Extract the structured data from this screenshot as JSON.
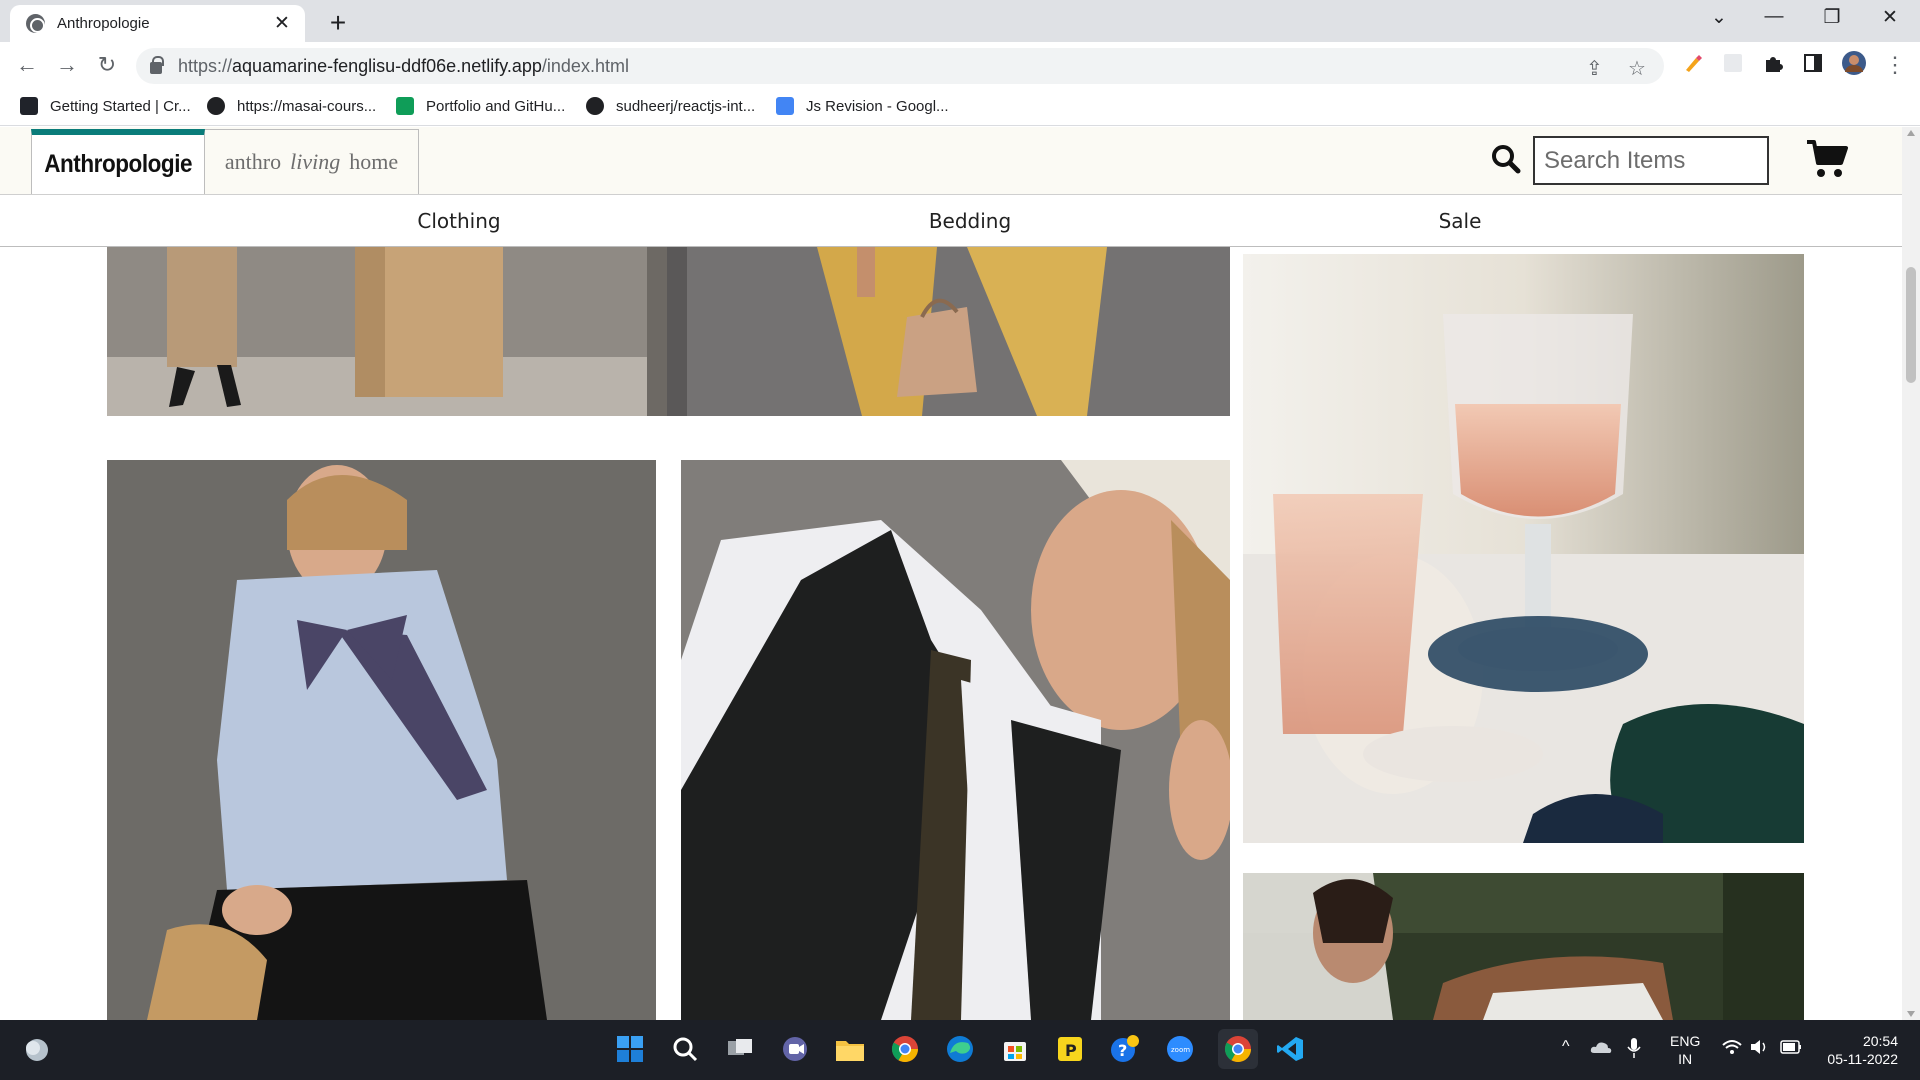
{
  "browser": {
    "tab_title": "Anthropologie",
    "url_scheme": "https://",
    "url_host": "aquamarine-fenglisu-ddf06e.netlify.app",
    "url_path": "/index.html",
    "bookmarks": [
      {
        "label": "Getting Started | Cr...",
        "icon": "react-icon",
        "color": "#20232a"
      },
      {
        "label": "https://masai-cours...",
        "icon": "globe-icon",
        "color": "#202124"
      },
      {
        "label": "Portfolio and GitHu...",
        "icon": "sheets-icon",
        "color": "#0f9d58"
      },
      {
        "label": "sudheerj/reactjs-int...",
        "icon": "github-icon",
        "color": "#202124"
      },
      {
        "label": "Js Revision - Googl...",
        "icon": "docs-icon",
        "color": "#4285f4"
      }
    ]
  },
  "site": {
    "brand": "Anthropologie",
    "home_tab": {
      "part1": "anthro",
      "part2": "living",
      "part3": "home"
    },
    "search_placeholder": "Search Items",
    "nav": [
      "Clothing",
      "Bedding",
      "Sale"
    ],
    "accent_color": "#0a7c7a"
  },
  "gallery": [
    {
      "name": "photo-model-tan-trousers-boxes"
    },
    {
      "name": "photo-model-yellow-check-trousers-handbag"
    },
    {
      "name": "photo-rose-wine-glasses-coasters"
    },
    {
      "name": "photo-model-blue-shirt-bow"
    },
    {
      "name": "photo-model-white-shirt-black-vest"
    },
    {
      "name": "photo-bride-veil-garden"
    }
  ],
  "taskbar": {
    "language": "ENG",
    "region": "IN",
    "time": "20:54",
    "date": "05-11-2022"
  }
}
